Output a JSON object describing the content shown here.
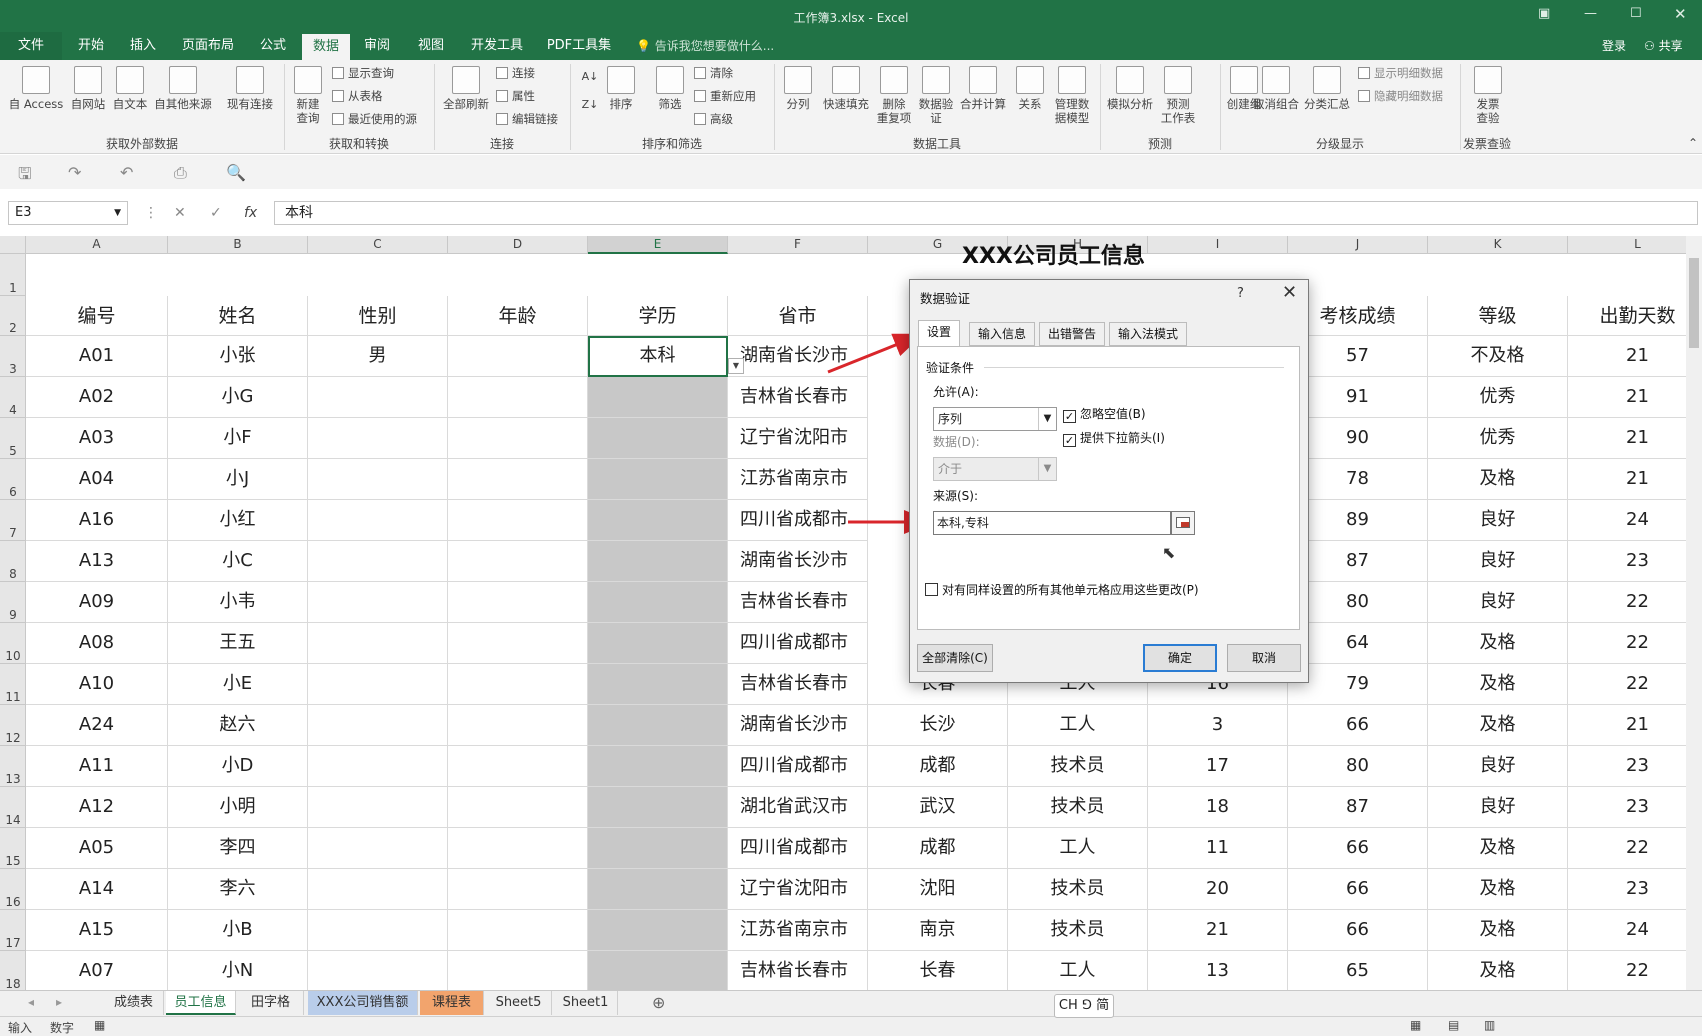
{
  "window": {
    "title": "工作簿3.xlsx - Excel"
  },
  "ribbon_tabs": [
    {
      "label": "文件"
    },
    {
      "label": "开始"
    },
    {
      "label": "插入"
    },
    {
      "label": "页面布局"
    },
    {
      "label": "公式"
    },
    {
      "label": "数据"
    },
    {
      "label": "审阅"
    },
    {
      "label": "视图"
    },
    {
      "label": "开发工具"
    },
    {
      "label": "PDF工具集"
    }
  ],
  "tell_me": "告诉我您想要做什么...",
  "account": {
    "login": "登录",
    "share": "共享"
  },
  "ribbon": {
    "from_access": "自 Access",
    "from_web": "自网站",
    "from_text": "自文本",
    "from_other": "自其他来源",
    "existing_conn": "现有连接",
    "new_query_1": "新建",
    "new_query_2": "查询",
    "show_query": "显示查询",
    "from_table": "从表格",
    "recent_sources": "最近使用的源",
    "refresh_all": "全部刷新",
    "connections": "连接",
    "properties": "属性",
    "edit_links": "编辑链接",
    "sort": "排序",
    "filter": "筛选",
    "clear": "清除",
    "reapply": "重新应用",
    "advanced": "高级",
    "text_to_cols": "分列",
    "flash_fill": "快速填充",
    "remove_dup_1": "删除",
    "remove_dup_2": "重复项",
    "validation_1": "数据验",
    "validation_2": "证",
    "consolidate": "合并计算",
    "relations": "关系",
    "data_model_1": "管理数",
    "data_model_2": "据模型",
    "what_if": "模拟分析",
    "forecast_1": "预测",
    "forecast_2": "工作表",
    "group": "创建组",
    "ungroup": "取消组合",
    "subtotal": "分类汇总",
    "show_detail": "显示明细数据",
    "hide_detail": "隐藏明细数据",
    "invoice_1": "发票",
    "invoice_2": "查验",
    "groups": {
      "get_external": "获取外部数据",
      "get_transform": "获取和转换",
      "connections": "连接",
      "sort_filter": "排序和筛选",
      "data_tools": "数据工具",
      "forecast": "预测",
      "outline": "分级显示",
      "invoice": "发票查验"
    }
  },
  "formula_bar": {
    "name_box": "E3",
    "fx": "fx",
    "content": "本科"
  },
  "columns": [
    "A",
    "B",
    "C",
    "D",
    "E",
    "F",
    "G",
    "H",
    "I",
    "J",
    "K",
    "L"
  ],
  "sheet_title": "XXX公司员工信息",
  "headers": [
    "编号",
    "姓名",
    "性别",
    "年龄",
    "学历",
    "省市",
    "",
    "",
    "",
    "考核成绩",
    "等级",
    "出勤天数"
  ],
  "rows": [
    {
      "n": "3",
      "a": "A01",
      "b": "小张",
      "c": "男",
      "e": "本科",
      "f": "湖南省长沙市",
      "g": "",
      "h": "",
      "i": "",
      "j": "57",
      "k": "不及格",
      "l": "21"
    },
    {
      "n": "4",
      "a": "A02",
      "b": "小G",
      "c": "",
      "e": "",
      "f": "吉林省长春市",
      "g": "",
      "h": "",
      "i": "",
      "j": "91",
      "k": "优秀",
      "l": "21"
    },
    {
      "n": "5",
      "a": "A03",
      "b": "小F",
      "c": "",
      "e": "",
      "f": "辽宁省沈阳市",
      "g": "",
      "h": "",
      "i": "",
      "j": "90",
      "k": "优秀",
      "l": "21"
    },
    {
      "n": "6",
      "a": "A04",
      "b": "小J",
      "c": "",
      "e": "",
      "f": "江苏省南京市",
      "g": "",
      "h": "",
      "i": "",
      "j": "78",
      "k": "及格",
      "l": "21"
    },
    {
      "n": "7",
      "a": "A16",
      "b": "小红",
      "c": "",
      "e": "",
      "f": "四川省成都市",
      "g": "",
      "h": "",
      "i": "",
      "j": "89",
      "k": "良好",
      "l": "24"
    },
    {
      "n": "8",
      "a": "A13",
      "b": "小C",
      "c": "",
      "e": "",
      "f": "湖南省长沙市",
      "g": "",
      "h": "",
      "i": "",
      "j": "87",
      "k": "良好",
      "l": "23"
    },
    {
      "n": "9",
      "a": "A09",
      "b": "小韦",
      "c": "",
      "e": "",
      "f": "吉林省长春市",
      "g": "",
      "h": "",
      "i": "",
      "j": "80",
      "k": "良好",
      "l": "22"
    },
    {
      "n": "10",
      "a": "A08",
      "b": "王五",
      "c": "",
      "e": "",
      "f": "四川省成都市",
      "g": "",
      "h": "",
      "i": "",
      "j": "64",
      "k": "及格",
      "l": "22"
    },
    {
      "n": "11",
      "a": "A10",
      "b": "小E",
      "c": "",
      "e": "",
      "f": "吉林省长春市",
      "g": "长春",
      "h": "工人",
      "i": "16",
      "j": "79",
      "k": "及格",
      "l": "22"
    },
    {
      "n": "12",
      "a": "A24",
      "b": "赵六",
      "c": "",
      "e": "",
      "f": "湖南省长沙市",
      "g": "长沙",
      "h": "工人",
      "i": "3",
      "j": "66",
      "k": "及格",
      "l": "21"
    },
    {
      "n": "13",
      "a": "A11",
      "b": "小D",
      "c": "",
      "e": "",
      "f": "四川省成都市",
      "g": "成都",
      "h": "技术员",
      "i": "17",
      "j": "80",
      "k": "良好",
      "l": "23"
    },
    {
      "n": "14",
      "a": "A12",
      "b": "小明",
      "c": "",
      "e": "",
      "f": "湖北省武汉市",
      "g": "武汉",
      "h": "技术员",
      "i": "18",
      "j": "87",
      "k": "良好",
      "l": "23"
    },
    {
      "n": "15",
      "a": "A05",
      "b": "李四",
      "c": "",
      "e": "",
      "f": "四川省成都市",
      "g": "成都",
      "h": "工人",
      "i": "11",
      "j": "66",
      "k": "及格",
      "l": "22"
    },
    {
      "n": "16",
      "a": "A14",
      "b": "李六",
      "c": "",
      "e": "",
      "f": "辽宁省沈阳市",
      "g": "沈阳",
      "h": "技术员",
      "i": "20",
      "j": "66",
      "k": "及格",
      "l": "23"
    },
    {
      "n": "17",
      "a": "A15",
      "b": "小B",
      "c": "",
      "e": "",
      "f": "江苏省南京市",
      "g": "南京",
      "h": "技术员",
      "i": "21",
      "j": "66",
      "k": "及格",
      "l": "24"
    },
    {
      "n": "18",
      "a": "A07",
      "b": "小N",
      "c": "",
      "e": "",
      "f": "吉林省长春市",
      "g": "长春",
      "h": "工人",
      "i": "13",
      "j": "65",
      "k": "及格",
      "l": "22"
    }
  ],
  "sheet_tabs": [
    {
      "label": "成绩表"
    },
    {
      "label": "员工信息"
    },
    {
      "label": "田字格"
    },
    {
      "label": "XXX公司销售额"
    },
    {
      "label": "课程表"
    },
    {
      "label": "Sheet5"
    },
    {
      "label": "Sheet1"
    }
  ],
  "status": {
    "mode1": "输入",
    "mode2": "数字",
    "ime": "CH ⅁ 简"
  },
  "dialog": {
    "title": "数据验证",
    "help": "?",
    "tabs": [
      {
        "label": "设置"
      },
      {
        "label": "输入信息"
      },
      {
        "label": "出错警告"
      },
      {
        "label": "输入法模式"
      }
    ],
    "section": "验证条件",
    "allow_label": "允许(A):",
    "allow_value": "序列",
    "ignore_blank": "忽略空值(B)",
    "dropdown_arrow": "提供下拉箭头(I)",
    "data_label": "数据(D):",
    "data_value": "介于",
    "source_label": "来源(S):",
    "source_value": "本科,专科",
    "apply_all": "对有同样设置的所有其他单元格应用这些更改(P)",
    "clear_all": "全部清除(C)",
    "ok": "确定",
    "cancel": "取消"
  },
  "colors": {
    "excel_green": "#217346",
    "annotation_red": "#d9262b"
  }
}
